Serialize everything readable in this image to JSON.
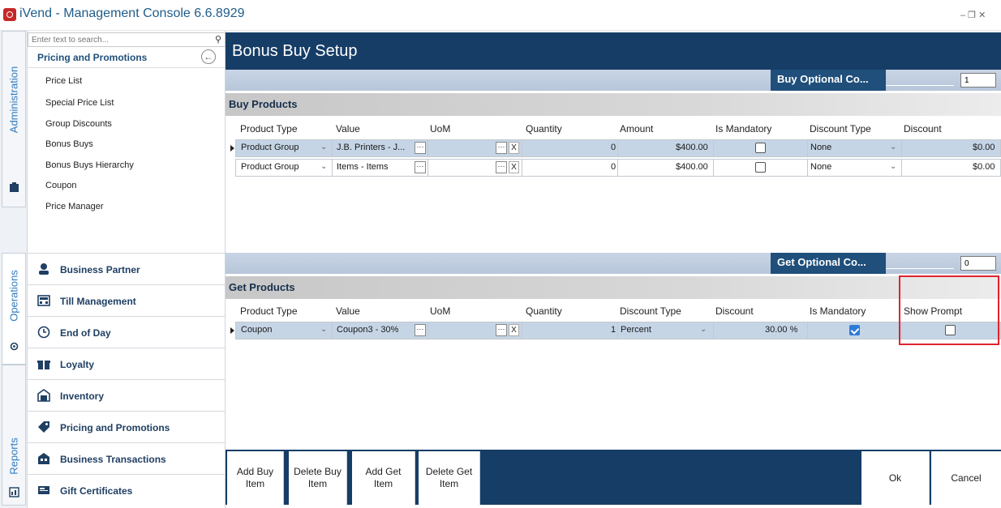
{
  "app": {
    "title": "iVend - Management Console  6.6.8929",
    "window_controls": "–  ❐  ✕"
  },
  "sidebar_tabs": [
    {
      "label": "Administration"
    },
    {
      "label": "Operations"
    },
    {
      "label": "Reports"
    }
  ],
  "search": {
    "placeholder": "Enter text to search..."
  },
  "nav": {
    "header": "Pricing and Promotions",
    "items": [
      "Price List",
      "Special Price List",
      "Group Discounts",
      "Bonus Buys",
      "Bonus Buys Hierarchy",
      "Coupon",
      "Price Manager"
    ]
  },
  "modules": [
    {
      "label": "Business Partner",
      "icon": "business-partner-icon"
    },
    {
      "label": "Till Management",
      "icon": "till-icon"
    },
    {
      "label": "End of Day",
      "icon": "clock-icon"
    },
    {
      "label": "Loyalty",
      "icon": "gift-icon"
    },
    {
      "label": "Inventory",
      "icon": "warehouse-icon"
    },
    {
      "label": "Pricing and Promotions",
      "icon": "tag-icon"
    },
    {
      "label": "Business Transactions",
      "icon": "transactions-icon"
    },
    {
      "label": "Gift Certificates",
      "icon": "certificate-icon"
    }
  ],
  "page": {
    "title": "Bonus Buy Setup"
  },
  "buy": {
    "optional_label": "Buy Optional Co...",
    "optional_value": "1",
    "section_title": "Buy Products",
    "columns": [
      "Product Type",
      "Value",
      "UoM",
      "Quantity",
      "Amount",
      "Is Mandatory",
      "Discount Type",
      "Discount"
    ],
    "rows": [
      {
        "product_type": "Product Group",
        "value": "J.B. Printers - J...",
        "uom": "",
        "x": "X",
        "quantity": "0",
        "amount": "$400.00",
        "mandatory": false,
        "discount_type": "None",
        "discount": "$0.00"
      },
      {
        "product_type": "Product Group",
        "value": "Items - Items",
        "uom": "",
        "x": "X",
        "quantity": "0",
        "amount": "$400.00",
        "mandatory": false,
        "discount_type": "None",
        "discount": "$0.00"
      }
    ]
  },
  "get": {
    "optional_label": "Get Optional Co...",
    "optional_value": "0",
    "section_title": "Get Products",
    "columns": [
      "Product Type",
      "Value",
      "UoM",
      "Quantity",
      "Discount Type",
      "Discount",
      "Is Mandatory",
      "Show Prompt"
    ],
    "rows": [
      {
        "product_type": "Coupon",
        "value": "Coupon3 - 30%",
        "uom": "",
        "x": "X",
        "quantity": "1",
        "discount_type": "Percent",
        "discount": "30.00 %",
        "mandatory": true,
        "show_prompt": false
      }
    ]
  },
  "buttons": {
    "add_buy": [
      "Add Buy",
      "Item"
    ],
    "delete_buy": [
      "Delete Buy",
      "Item"
    ],
    "add_get": [
      "Add Get",
      "Item"
    ],
    "delete_get": [
      "Delete Get",
      "Item"
    ],
    "ok": "Ok",
    "cancel": "Cancel"
  },
  "colors": {
    "navy": "#163d66",
    "accent_blue": "#2f7bc0",
    "highlight_red": "#e0242e"
  }
}
